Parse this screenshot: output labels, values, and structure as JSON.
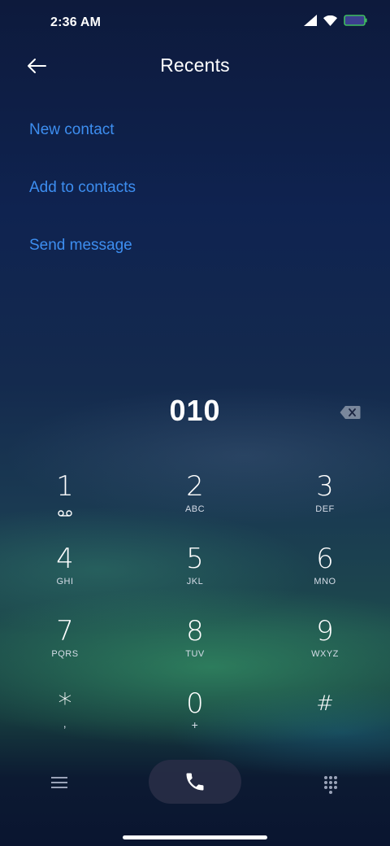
{
  "status_bar": {
    "time": "2:36 AM",
    "icons": [
      "signal-icon",
      "wifi-icon",
      "battery-icon"
    ],
    "battery_color": "#3b3f8f",
    "battery_border": "#3fbf5f"
  },
  "header": {
    "title": "Recents",
    "back_icon": "arrow-left-icon"
  },
  "actions": [
    {
      "label": "New contact"
    },
    {
      "label": "Add to contacts"
    },
    {
      "label": "Send message"
    }
  ],
  "dial": {
    "number": "010",
    "backspace_icon": "backspace-icon"
  },
  "keypad": [
    {
      "digit": "1",
      "letters": "",
      "sub_icon": "voicemail-icon"
    },
    {
      "digit": "2",
      "letters": "ABC"
    },
    {
      "digit": "3",
      "letters": "DEF"
    },
    {
      "digit": "4",
      "letters": "GHI"
    },
    {
      "digit": "5",
      "letters": "JKL"
    },
    {
      "digit": "6",
      "letters": "MNO"
    },
    {
      "digit": "7",
      "letters": "PQRS"
    },
    {
      "digit": "8",
      "letters": "TUV"
    },
    {
      "digit": "9",
      "letters": "WXYZ"
    },
    {
      "digit": "*",
      "letters": ","
    },
    {
      "digit": "0",
      "letters": "+"
    },
    {
      "digit": "#",
      "letters": ""
    }
  ],
  "bottom_nav": {
    "menu_icon": "menu-icon",
    "call_icon": "phone-icon",
    "dialpad_icon": "dialpad-icon"
  },
  "colors": {
    "accent": "#3d8ef0",
    "call_button_bg": "#282d46"
  }
}
